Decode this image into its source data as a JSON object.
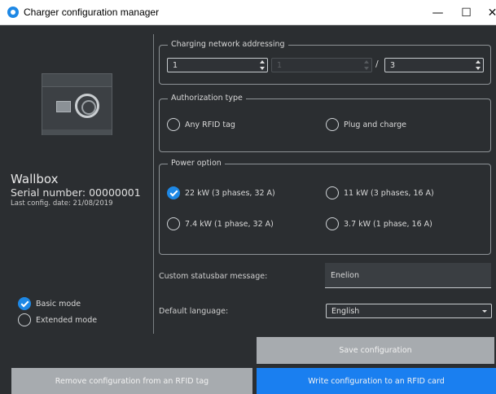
{
  "window": {
    "title": "Charger configuration manager",
    "min_glyph": "—",
    "max_glyph": "☐",
    "close_glyph": "✕"
  },
  "device": {
    "name": "Wallbox",
    "serial": "Serial number: 00000001",
    "last_config": "Last config. date: 21/08/2019"
  },
  "mode": {
    "options": [
      {
        "label": "Basic mode",
        "checked": true
      },
      {
        "label": "Extended mode",
        "checked": false
      }
    ]
  },
  "addressing": {
    "legend": "Charging network addressing",
    "first": "1",
    "middle": "1",
    "separator": "/",
    "last": "3"
  },
  "authorization": {
    "legend": "Authorization type",
    "options": [
      {
        "label": "Any RFID tag",
        "checked": false
      },
      {
        "label": "Plug and charge",
        "checked": false
      }
    ]
  },
  "power": {
    "legend": "Power option",
    "options": [
      {
        "label": "22 kW (3 phases, 32 A)",
        "checked": true
      },
      {
        "label": "11 kW (3 phases, 16 A)",
        "checked": false
      },
      {
        "label": "7.4 kW (1 phase, 32 A)",
        "checked": false
      },
      {
        "label": "3.7 kW (1 phase, 16 A)",
        "checked": false
      }
    ]
  },
  "statusbar": {
    "label": "Custom statusbar message:",
    "value": "Enelion"
  },
  "language": {
    "label": "Default language:",
    "selected": "English"
  },
  "buttons": {
    "save": "Save configuration",
    "remove": "Remove configuration from an RFID tag",
    "write": "Write configuration to an RFID card"
  },
  "colors": {
    "accent": "#1a7ff0",
    "background": "#2b2e31",
    "disabled_button": "#a7abaf"
  }
}
